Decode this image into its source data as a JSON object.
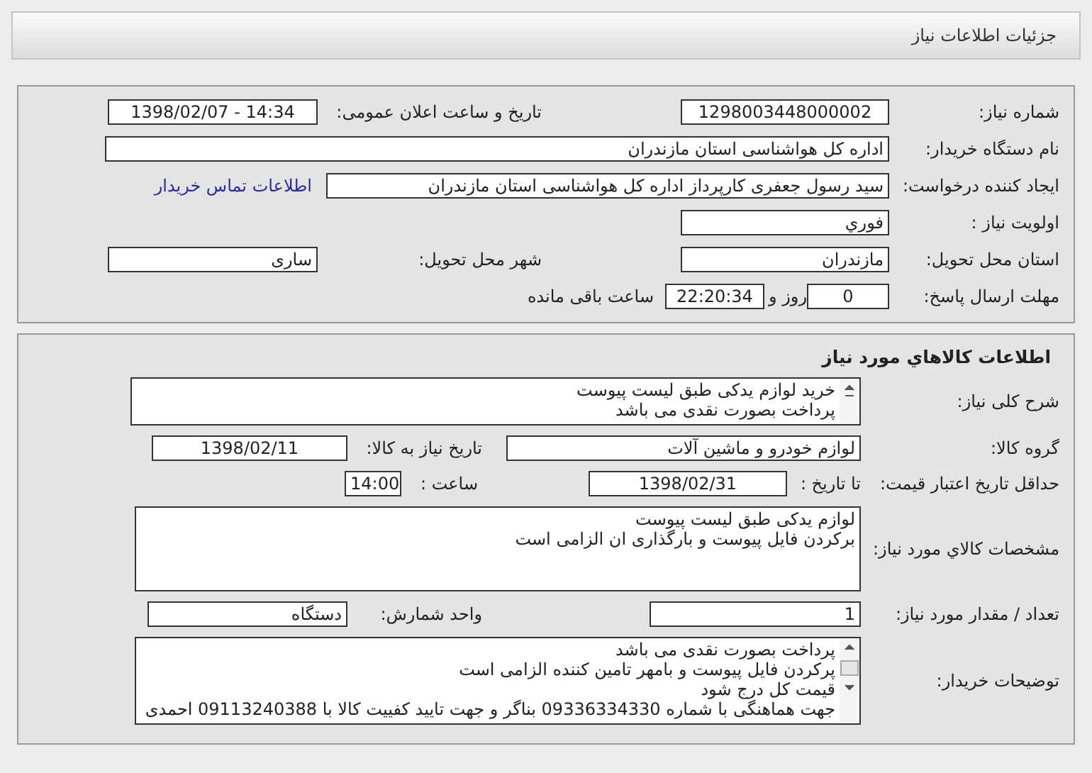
{
  "header": {
    "title": "جزئیات اطلاعات نیاز"
  },
  "need_info": {
    "need_number": {
      "label": "شماره نیاز:",
      "value": "1298003448000002"
    },
    "announce_datetime": {
      "label": "تاریخ و ساعت اعلان عمومی:",
      "value": "1398/02/07 - 14:34"
    },
    "buyer_org": {
      "label": "نام دستگاه خریدار:",
      "value": "اداره کل هواشناسی استان مازندران"
    },
    "requester": {
      "label": "ایجاد کننده درخواست:",
      "value": "سید رسول  جعفری کارپرداز اداره کل هواشناسی استان مازندران"
    },
    "buyer_contact_link": "اطلاعات تماس خریدار",
    "priority": {
      "label": "اولویت نیاز :",
      "value": "فوري"
    },
    "delivery_province": {
      "label": "استان محل تحویل:",
      "value": "مازندران"
    },
    "delivery_city": {
      "label": "شهر محل تحویل:",
      "value": "ساری"
    },
    "deadline": {
      "label": "مهلت ارسال پاسخ:",
      "days": "0",
      "days_unit": "روز و",
      "time": "22:20:34",
      "time_suffix": "ساعت باقی مانده"
    }
  },
  "goods_info": {
    "heading": "اطلاعات كالاهاي مورد نياز",
    "general_description": {
      "label": "شرح کلی نیاز:",
      "lines": [
        "خرید لوازم یدکی طبق لیست پیوست",
        "پرداخت بصورت نقدی می باشد"
      ]
    },
    "goods_group": {
      "label": "گروه کالا:",
      "value": "لوازم خودرو و ماشین آلات"
    },
    "need_date": {
      "label": "تاریخ نیاز به کالا:",
      "value": "1398/02/11"
    },
    "price_validity": {
      "label": "حداقل تاریخ اعتبار قیمت:",
      "until_label": "تا تاریخ :",
      "date": "1398/02/31",
      "time_label": "ساعت :",
      "time": "14:00"
    },
    "specifications": {
      "label": "مشخصات کالاي مورد نیاز:",
      "lines": [
        "لوازم یدکی طبق لیست پیوست",
        "برکردن فایل پیوست و بارگذاری ان الزامی است"
      ]
    },
    "quantity": {
      "label": "تعداد / مقدار مورد نیاز:",
      "value": "1"
    },
    "unit": {
      "label": "واحد شمارش:",
      "value": "دستگاه"
    },
    "buyer_notes": {
      "label": "توضیحات خریدار:",
      "lines": [
        "پرداخت بصورت نقدی می باشد",
        "پرکردن فایل پیوست و بامهر تامین کننده الزامی است",
        "قیمت کل درج شود",
        "جهت هماهنگی با شماره 09336334330 بناگر و جهت تایید کفییت کالا با 09113240388 احمدی"
      ]
    }
  }
}
